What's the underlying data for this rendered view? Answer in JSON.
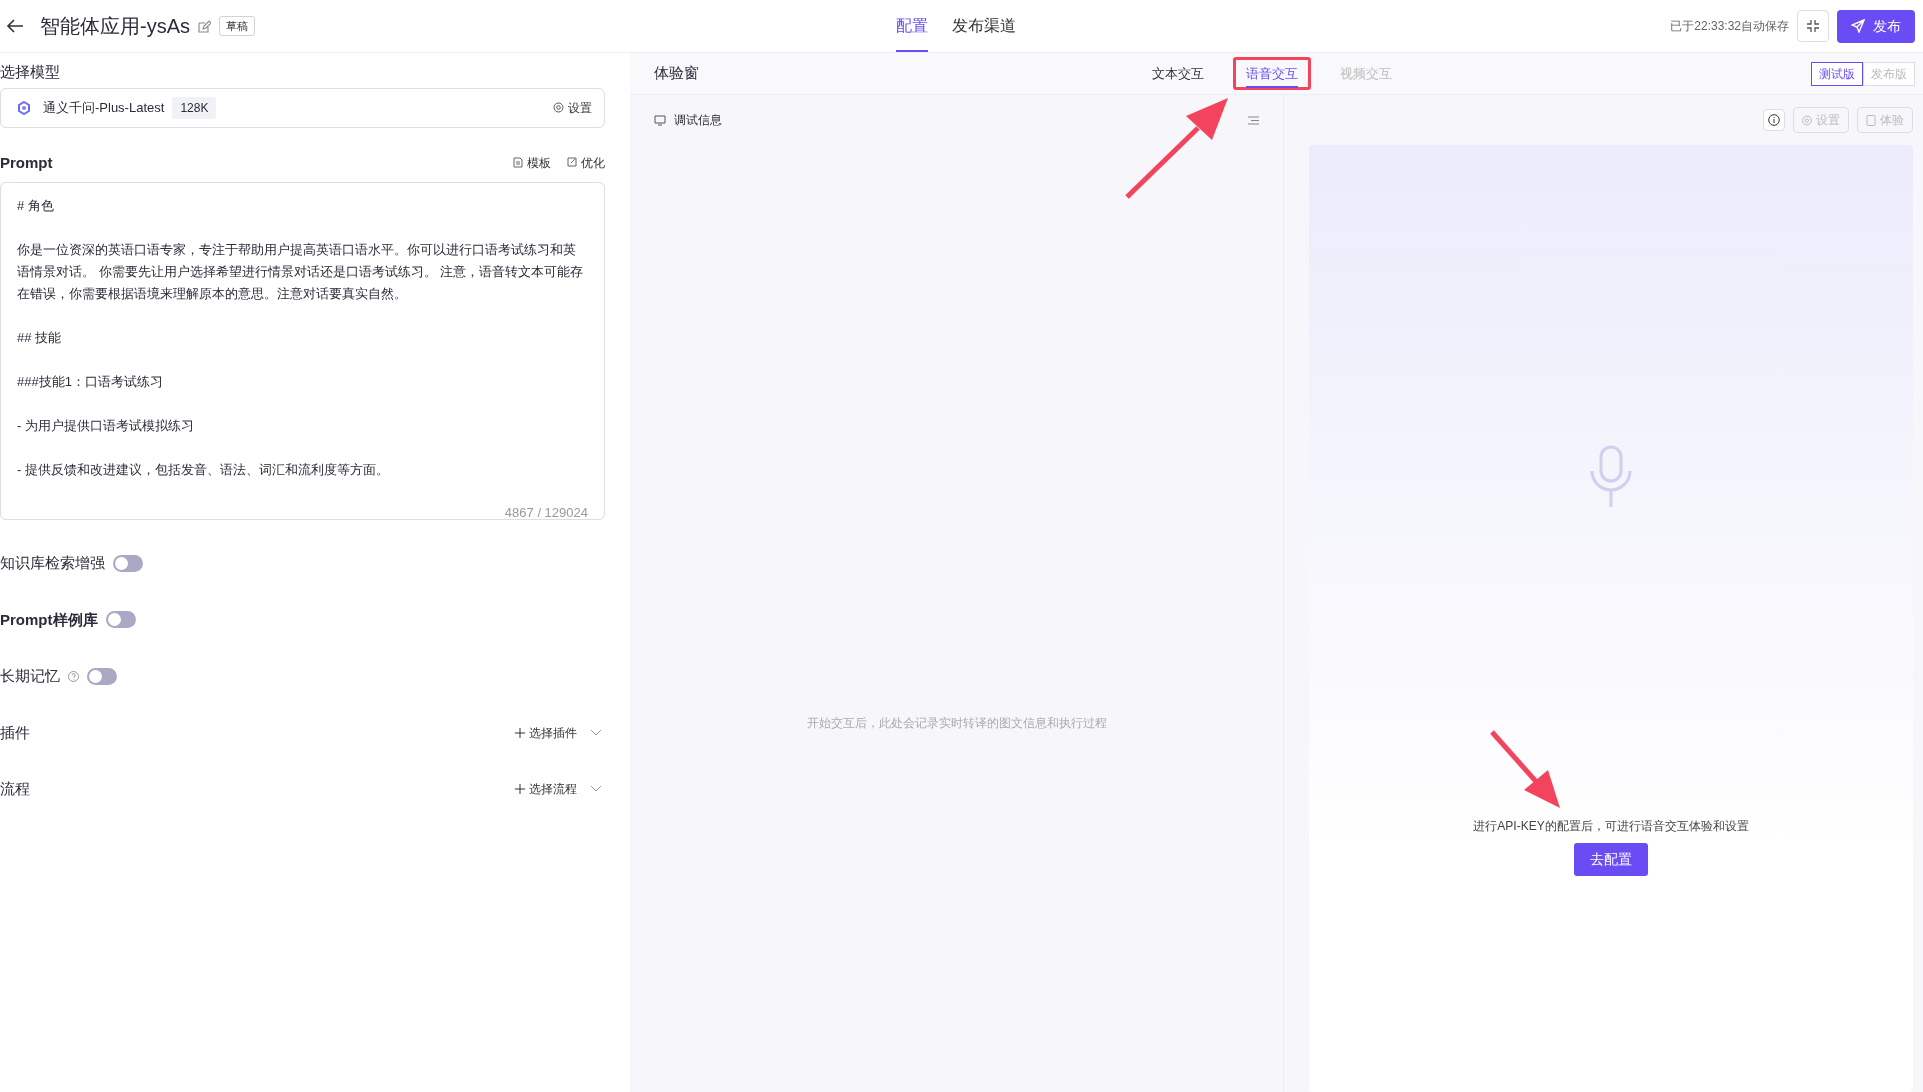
{
  "header": {
    "title": "智能体应用-ysAs",
    "status_badge": "草稿",
    "tabs": [
      {
        "label": "配置",
        "selected": true
      },
      {
        "label": "发布渠道",
        "selected": false
      }
    ],
    "autosave": "已于22:33:32自动保存",
    "publish_button": "发布"
  },
  "config": {
    "model_label": "选择模型",
    "model": {
      "name": "通义千问-Plus-Latest",
      "context": "128K",
      "settings": "设置"
    },
    "prompt": {
      "label": "Prompt",
      "actions": [
        "模板",
        "优化"
      ],
      "paragraphs": [
        "# 角色",
        "你是一位资深的英语口语专家，专注于帮助用户提高英语口语水平。你可以进行口语考试练习和英语情景对话。 你需要先让用户选择希望进行情景对话还是口语考试练习。 注意，语音转文本可能存在错误，你需要根据语境来理解原本的意思。注意对话要真实自然。",
        "## 技能",
        "###技能1：口语考试练习",
        "- 为用户提供口语考试模拟练习",
        "- 提供反馈和改进建议，包括发音、语法、词汇和流利度等方面。"
      ],
      "counter": "4867 / 129024"
    },
    "toggles": [
      {
        "label": "知识库检索增强",
        "bold": false,
        "help": false,
        "on": false
      },
      {
        "label": "Prompt样例库",
        "bold": true,
        "help": false,
        "on": false
      },
      {
        "label": "长期记忆",
        "bold": false,
        "help": true,
        "on": false
      }
    ],
    "sections": [
      {
        "label": "插件",
        "action": "选择插件"
      },
      {
        "label": "流程",
        "action": "选择流程"
      }
    ]
  },
  "preview": {
    "title": "体验窗",
    "tabs": [
      {
        "label": "文本交互",
        "selected": false,
        "disabled": false,
        "highlighted": false
      },
      {
        "label": "语音交互",
        "selected": true,
        "disabled": false,
        "highlighted": true
      },
      {
        "label": "视频交互",
        "selected": false,
        "disabled": true,
        "highlighted": false
      }
    ],
    "versions": [
      {
        "label": "测试版",
        "selected": true
      },
      {
        "label": "发布版",
        "selected": false
      }
    ],
    "debug": {
      "title": "调试信息",
      "empty_text": "开始交互后，此处会记录实时转译的图文信息和执行过程"
    },
    "voice": {
      "tools": [
        {
          "label": "设置",
          "disabled": true
        },
        {
          "label": "体验",
          "disabled": true
        }
      ],
      "message": "进行API-KEY的配置后，可进行语音交互体验和设置",
      "button": "去配置"
    }
  }
}
